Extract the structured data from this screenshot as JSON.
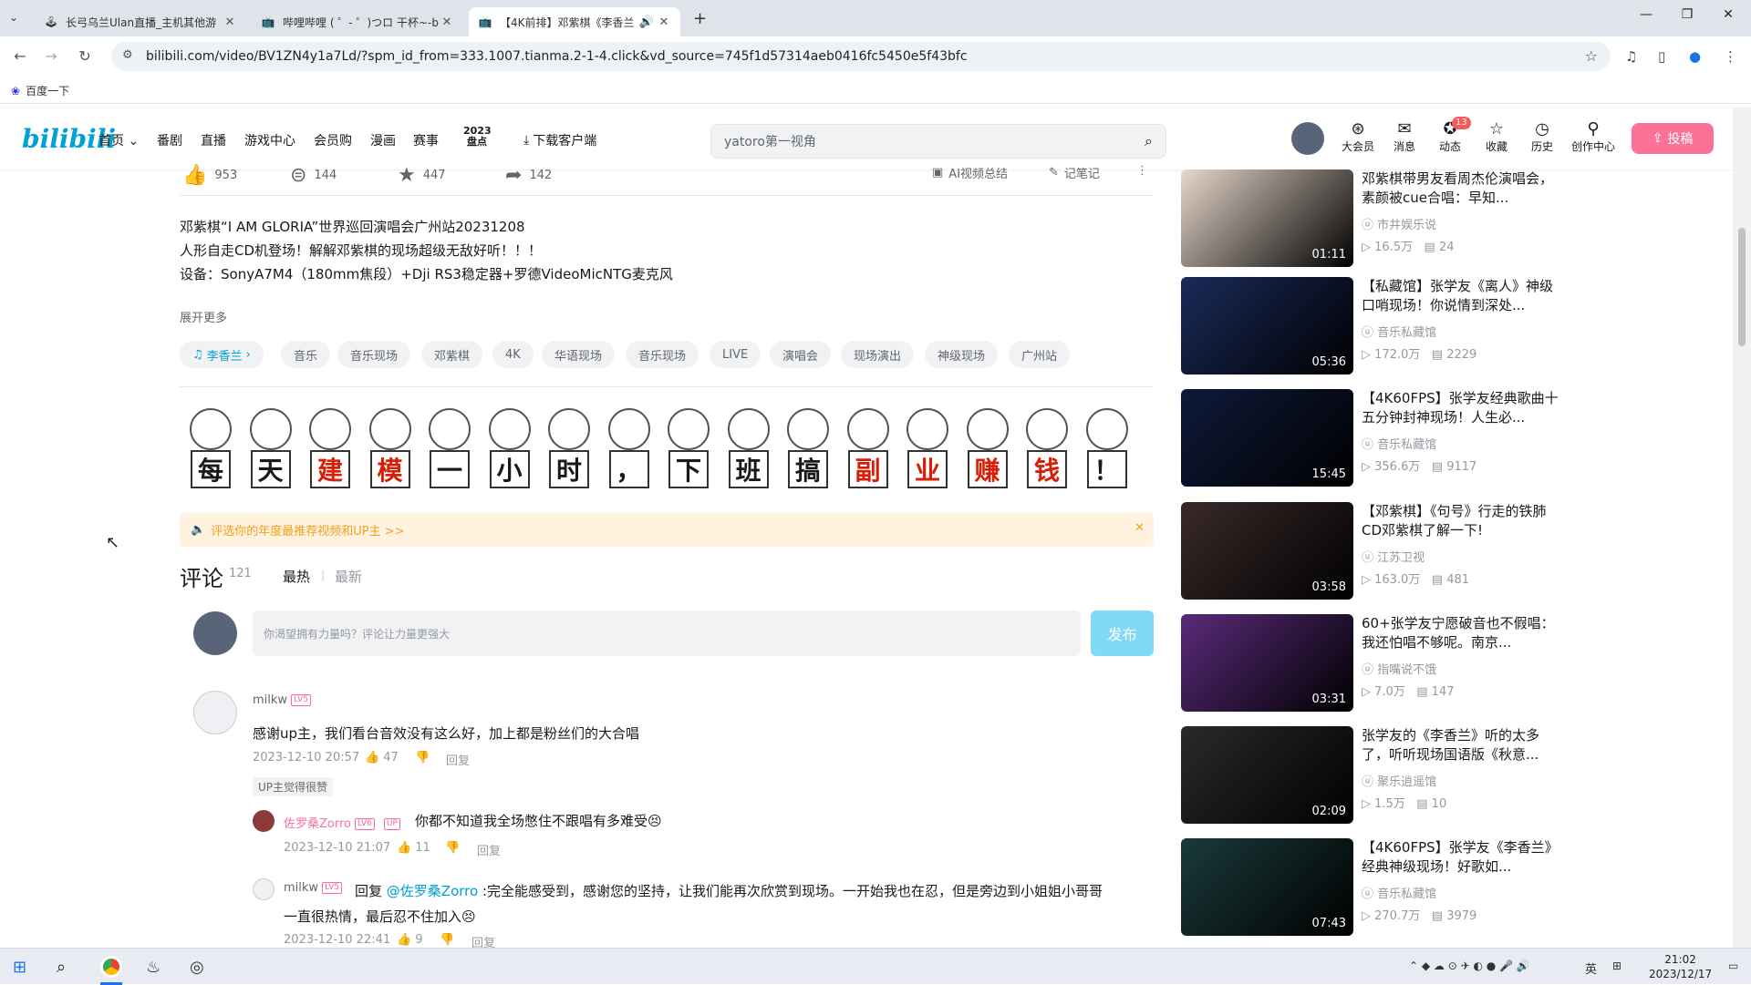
{
  "browser": {
    "tabs": [
      {
        "title": "长弓乌兰Ulan直播_主机其他游"
      },
      {
        "title": "哔哩哔哩 ( ゜- ゜)つロ 干杯~-bi"
      },
      {
        "title": "【4K前排】邓紫棋《李香兰"
      }
    ],
    "url": "bilibili.com/video/BV1ZN4y1a7Ld/?spm_id_from=333.1007.tianma.2-1-4.click&vd_source=745f1d57314aeb0416fc5450e5f43bfc",
    "bookmark": "百度一下"
  },
  "header": {
    "logo": "bilibili",
    "nav": [
      "首页",
      "番剧",
      "直播",
      "游戏中心",
      "会员购",
      "漫画",
      "赛事"
    ],
    "badge": "2023 盘点",
    "download": "下载客户端",
    "search_placeholder": "yatoro第一视角",
    "icons": [
      {
        "label": "大会员",
        "icon": "vip-icon"
      },
      {
        "label": "消息",
        "icon": "message-icon"
      },
      {
        "label": "动态",
        "icon": "dynamic-icon",
        "badge": "13"
      },
      {
        "label": "收藏",
        "icon": "star-icon"
      },
      {
        "label": "历史",
        "icon": "clock-icon"
      },
      {
        "label": "创作中心",
        "icon": "bulb-icon"
      }
    ],
    "upload": "投稿"
  },
  "video": {
    "stats": {
      "like": "953",
      "coin": "144",
      "fav": "447",
      "share": "142"
    },
    "ai_summary": "AI视频总结",
    "notes": "记笔记",
    "desc": [
      "邓紫棋“I AM GLORIA”世界巡回演唱会广州站20231208",
      "人形自走CD机登场！解解邓紫棋的现场超级无敌好听！！！",
      "设备：SonyA7M4（180mm焦段）+Dji RS3稳定器+罗德VideoMicNTG麦克风"
    ],
    "expand": "展开更多",
    "tags": [
      "李香兰",
      "音乐",
      "音乐现场",
      "邓紫棋",
      "4K",
      "华语现场",
      "音乐现场",
      "LIVE",
      "演唱会",
      "现场演出",
      "神级现场",
      "广州站"
    ],
    "sticker_chars": [
      "每",
      "天",
      "建",
      "模",
      "一",
      "小",
      "时",
      "，",
      "下",
      "班",
      "搞",
      "副",
      "业",
      "赚",
      "钱",
      "！"
    ],
    "banner": "评选你的年度最推荐视频和UP主 >>"
  },
  "comments": {
    "title": "评论",
    "count": "121",
    "sort_hot": "最热",
    "sort_new": "最新",
    "input_placeholder": "你渴望拥有力量吗？评论让力量更强大",
    "post": "发布",
    "items": [
      {
        "user": "milkw",
        "level": "LV5",
        "text": "感谢up主，我们看台音效没有这么好，加上都是粉丝们的大合唱",
        "time": "2023-12-10 20:57",
        "likes": "47",
        "reply": "回复",
        "up_tag": "UP主觉得很赞"
      },
      {
        "user": "佐罗桑Zorro",
        "level": "LV6",
        "up": "UP",
        "text": "你都不知道我全场憋住不跟唱有多难受😣",
        "time": "2023-12-10 21:07",
        "likes": "11",
        "reply": "回复"
      },
      {
        "user": "milkw",
        "level": "LV5",
        "prefix": "回复",
        "mention": "@佐罗桑Zorro",
        "text": ":完全能感受到，感谢您的坚持，让我们能再次欣赏到现场。一开始我也在忍，但是旁边到小姐姐小哥哥",
        "text2": "一直很热情，最后忍不住加入😣",
        "time": "2023-12-10 22:41",
        "likes": "9",
        "reply": "回复"
      }
    ]
  },
  "recommend": [
    {
      "title": "邓紫棋带男友看周杰伦演唱会，素颜被cue合唱：早知...",
      "up": "市井娱乐说",
      "views": "16.5万",
      "danmaku": "24",
      "dur": "01:11",
      "color": "#e8d8cc"
    },
    {
      "title": "【私藏馆】张学友《离人》神级口哨现场！你说情到深处...",
      "up": "音乐私藏馆",
      "views": "172.0万",
      "danmaku": "2229",
      "dur": "05:36",
      "color": "#1a2a5a"
    },
    {
      "title": "【4K60FPS】张学友经典歌曲十五分钟封神现场！人生必...",
      "up": "音乐私藏馆",
      "views": "356.6万",
      "danmaku": "9117",
      "dur": "15:45",
      "color": "#0e1a3a"
    },
    {
      "title": "【邓紫棋】《句号》行走的铁肺CD邓紫棋了解一下!",
      "up": "江苏卫视",
      "views": "163.0万",
      "danmaku": "481",
      "dur": "03:58",
      "color": "#3a2a2a"
    },
    {
      "title": "60+张学友宁愿破音也不假唱：我还怕唱不够呢。南京...",
      "up": "指嘴说不饿",
      "views": "7.0万",
      "danmaku": "147",
      "dur": "03:31",
      "color": "#5a2a7a"
    },
    {
      "title": "张学友的《李香兰》听的太多了，听听现场国语版《秋意...",
      "up": "聚乐逍遥馆",
      "views": "1.5万",
      "danmaku": "10",
      "dur": "02:09",
      "color": "#2a2a2a"
    },
    {
      "title": "【4K60FPS】张学友《李香兰》经典神级现场！好歌如...",
      "up": "音乐私藏馆",
      "views": "270.7万",
      "danmaku": "3979",
      "dur": "07:43",
      "color": "#1a3a3a"
    }
  ],
  "taskbar": {
    "time": "21:02",
    "date": "2023/12/17",
    "ime": "英"
  }
}
